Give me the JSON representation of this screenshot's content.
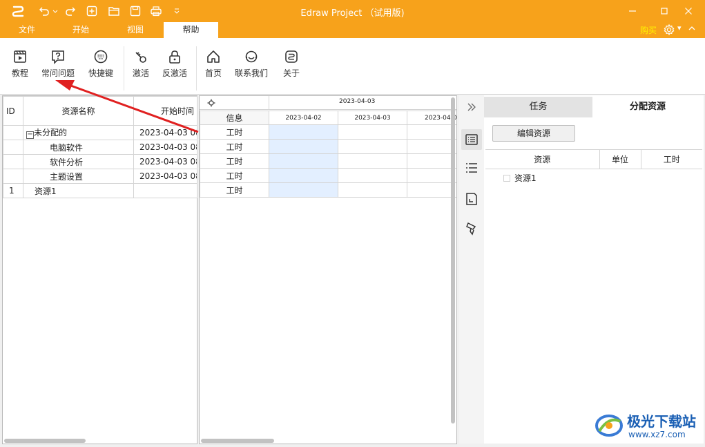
{
  "window": {
    "title": "Edraw Project （试用版)"
  },
  "menu": {
    "tabs": [
      "文件",
      "开始",
      "视图",
      "帮助"
    ],
    "active_index": 3,
    "buy_label": "购买"
  },
  "ribbon": {
    "buttons": [
      {
        "label": "教程",
        "icon": "video-tutorial-icon"
      },
      {
        "label": "常问问题",
        "icon": "question-bubble-icon"
      },
      {
        "label": "快捷键",
        "icon": "keyboard-icon"
      },
      {
        "label": "激活",
        "icon": "key-icon"
      },
      {
        "label": "反激活",
        "icon": "lock-icon"
      },
      {
        "label": "首页",
        "icon": "home-icon"
      },
      {
        "label": "联系我们",
        "icon": "headset-icon"
      },
      {
        "label": "关于",
        "icon": "app-logo-icon"
      }
    ]
  },
  "grid": {
    "headers": [
      "ID",
      "资源名称",
      "开始时间"
    ],
    "rows": [
      {
        "id": "",
        "name": "未分配的",
        "start": "2023-04-03 08",
        "toggle": "−"
      },
      {
        "id": "",
        "name": "电脑软件",
        "start": "2023-04-03 08"
      },
      {
        "id": "",
        "name": "软件分析",
        "start": "2023-04-03 08"
      },
      {
        "id": "",
        "name": "主题设置",
        "start": "2023-04-03 08"
      },
      {
        "id": "1",
        "name": "资源1",
        "start": ""
      }
    ]
  },
  "gantt": {
    "top_date": "2023-04-03",
    "info_header": "信息",
    "dates": [
      "2023-04-02",
      "2023-04-03",
      "2023-04-0"
    ],
    "row_labels": [
      "工时",
      "工时",
      "工时",
      "工时",
      "工时"
    ]
  },
  "right_panel": {
    "tabs": [
      "任务",
      "分配资源"
    ],
    "active_tab": 1,
    "edit_button": "编辑资源",
    "headers": [
      "资源",
      "单位",
      "工时"
    ],
    "items": [
      "资源1"
    ]
  },
  "watermark": {
    "name": "极光下载站",
    "url": "www.xz7.com"
  },
  "colors": {
    "brand": "#f7a21b",
    "buy": "#fff100",
    "arrow": "#e02020",
    "highlight": "#e3efff"
  }
}
